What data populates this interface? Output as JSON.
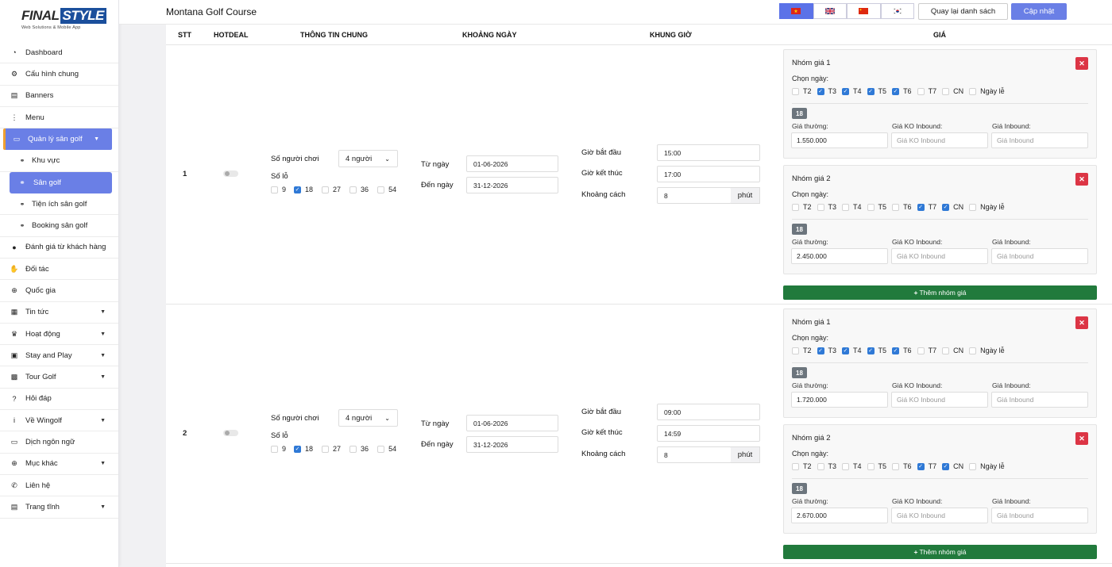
{
  "logo": {
    "final": "FINAL",
    "style": "STYLE",
    "tagline": "Web Solutions & Mobile App"
  },
  "sidebar": {
    "items": [
      {
        "label": "Dashboard",
        "icon": "dashboard-icon"
      },
      {
        "label": "Cấu hình chung",
        "icon": "gear-icon"
      },
      {
        "label": "Banners",
        "icon": "banner-icon"
      },
      {
        "label": "Menu",
        "icon": "menu-dots-icon"
      },
      {
        "label": "Quản lý sân golf",
        "icon": "monitor-icon",
        "chevron": true
      },
      {
        "label": "Khu vực",
        "icon": "sitemap-icon"
      },
      {
        "label": "Sân golf",
        "icon": "sitemap-icon"
      },
      {
        "label": "Tiện ích sân golf",
        "icon": "sitemap-icon"
      },
      {
        "label": "Booking sân golf",
        "icon": "sitemap-icon"
      },
      {
        "label": "Đánh giá từ khách hàng",
        "icon": "comment-icon"
      },
      {
        "label": "Đối tác",
        "icon": "handshake-icon"
      },
      {
        "label": "Quốc gia",
        "icon": "globe-icon"
      },
      {
        "label": "Tin tức",
        "icon": "news-icon",
        "chevron": true
      },
      {
        "label": "Hoạt động",
        "icon": "trophy-icon",
        "chevron": true
      },
      {
        "label": "Stay and Play",
        "icon": "hotel-icon",
        "chevron": true
      },
      {
        "label": "Tour Golf",
        "icon": "suitcase-icon",
        "chevron": true
      },
      {
        "label": "Hỏi đáp",
        "icon": "question-icon"
      },
      {
        "label": "Về Wingolf",
        "icon": "info-icon",
        "chevron": true
      },
      {
        "label": "Dịch ngôn ngữ",
        "icon": "language-icon"
      },
      {
        "label": "Mục khác",
        "icon": "globe-icon",
        "chevron": true
      },
      {
        "label": "Liên hệ",
        "icon": "phone-icon"
      },
      {
        "label": "Trang tĩnh",
        "icon": "file-icon",
        "chevron": true
      }
    ]
  },
  "header": {
    "title": "Montana Golf Course",
    "back_label": "Quay lại danh sách",
    "update_label": "Cập nhật",
    "flags": [
      "vietnam-flag-icon",
      "uk-flag-icon",
      "china-flag-icon",
      "korea-flag-icon"
    ]
  },
  "table": {
    "headers": [
      "STT",
      "HOTDEAL",
      "THÔNG TIN CHUNG",
      "KHOẢNG NGÀY",
      "KHUNG GIỜ",
      "GIÁ"
    ],
    "labels": {
      "players": "Số người chơi",
      "holes": "Số lỗ",
      "from_date": "Từ ngày",
      "to_date": "Đến ngày",
      "start_time": "Giờ bắt đầu",
      "end_time": "Giờ kết thúc",
      "interval": "Khoảng cách",
      "minute": "phút",
      "choose_day": "Chọn ngày:",
      "regular_price": "Giá thường:",
      "non_inbound_price": "Giá KO Inbound:",
      "inbound_price": "Giá Inbound:",
      "ph_non_inbound": "Giá KO Inbound",
      "ph_inbound": "Giá Inbound",
      "add_group": "Thêm nhóm giá",
      "badge": "18"
    },
    "hole_options": [
      "9",
      "18",
      "27",
      "36",
      "54"
    ],
    "day_options": [
      "T2",
      "T3",
      "T4",
      "T5",
      "T6",
      "T7",
      "CN",
      "Ngày lễ"
    ],
    "rows": [
      {
        "stt": "1",
        "players": "4 người",
        "from": "01-06-2026",
        "to": "31-12-2026",
        "start": "15:00",
        "end": "17:00",
        "interval": "8",
        "groups": [
          {
            "title": "Nhóm giá 1",
            "regular": "1.550.000"
          },
          {
            "title": "Nhóm giá 2",
            "regular": "2.450.000"
          }
        ]
      },
      {
        "stt": "2",
        "players": "4 người",
        "from": "01-06-2026",
        "to": "31-12-2026",
        "start": "09:00",
        "end": "14:59",
        "interval": "8",
        "groups": [
          {
            "title": "Nhóm giá 1",
            "regular": "1.720.000"
          },
          {
            "title": "Nhóm giá 2",
            "regular": "2.670.000"
          }
        ]
      }
    ]
  },
  "colors": {
    "accent": "#6a7fe6",
    "danger": "#dc3545",
    "success": "#217a3c",
    "checkbox": "#2f79d6"
  }
}
